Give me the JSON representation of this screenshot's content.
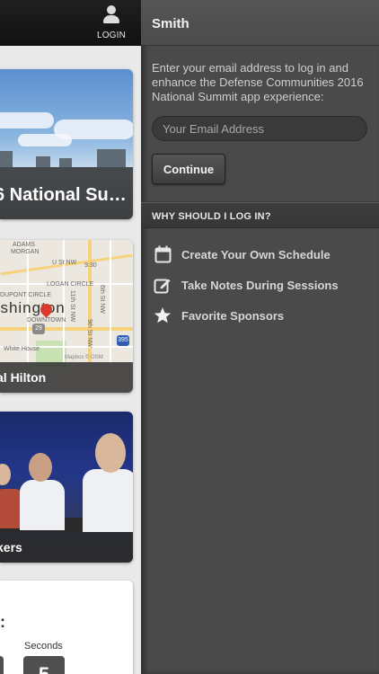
{
  "left": {
    "login_label": "LOGIN",
    "cards": [
      {
        "caption": "6 National Su…"
      },
      {
        "caption": "al Hilton",
        "map_city": "ashington",
        "map_labels": [
          "ADAMS",
          "MORGAN",
          "U St NW",
          "9:30",
          "LOGAN CIRCLE",
          "DUPONT CIRCLE",
          "DOWNTOWN",
          "White House",
          "29",
          "395",
          "11th St NW",
          "6th St NW",
          "9th St NW",
          "Mapbox © OSM"
        ]
      },
      {
        "caption": "kers"
      },
      {
        "colon": ":",
        "seconds_label": "Seconds",
        "seconds_value": "5"
      }
    ]
  },
  "drawer": {
    "title": "Smith",
    "intro": "Enter your email address to log in and enhance the Defense Communities 2016 National Summit app experience:",
    "email_placeholder": "Your Email Address",
    "continue_label": "Continue",
    "why_header": "WHY SHOULD I LOG IN?",
    "features": [
      {
        "icon": "calendar-icon",
        "label": "Create Your Own Schedule"
      },
      {
        "icon": "pencil-icon",
        "label": "Take Notes During Sessions"
      },
      {
        "icon": "star-icon",
        "label": "Favorite Sponsors"
      }
    ]
  },
  "colors": {
    "drawer_bg": "#4a4a4a",
    "topbar_bg": "#111111",
    "map_pin": "#d83a2e"
  }
}
